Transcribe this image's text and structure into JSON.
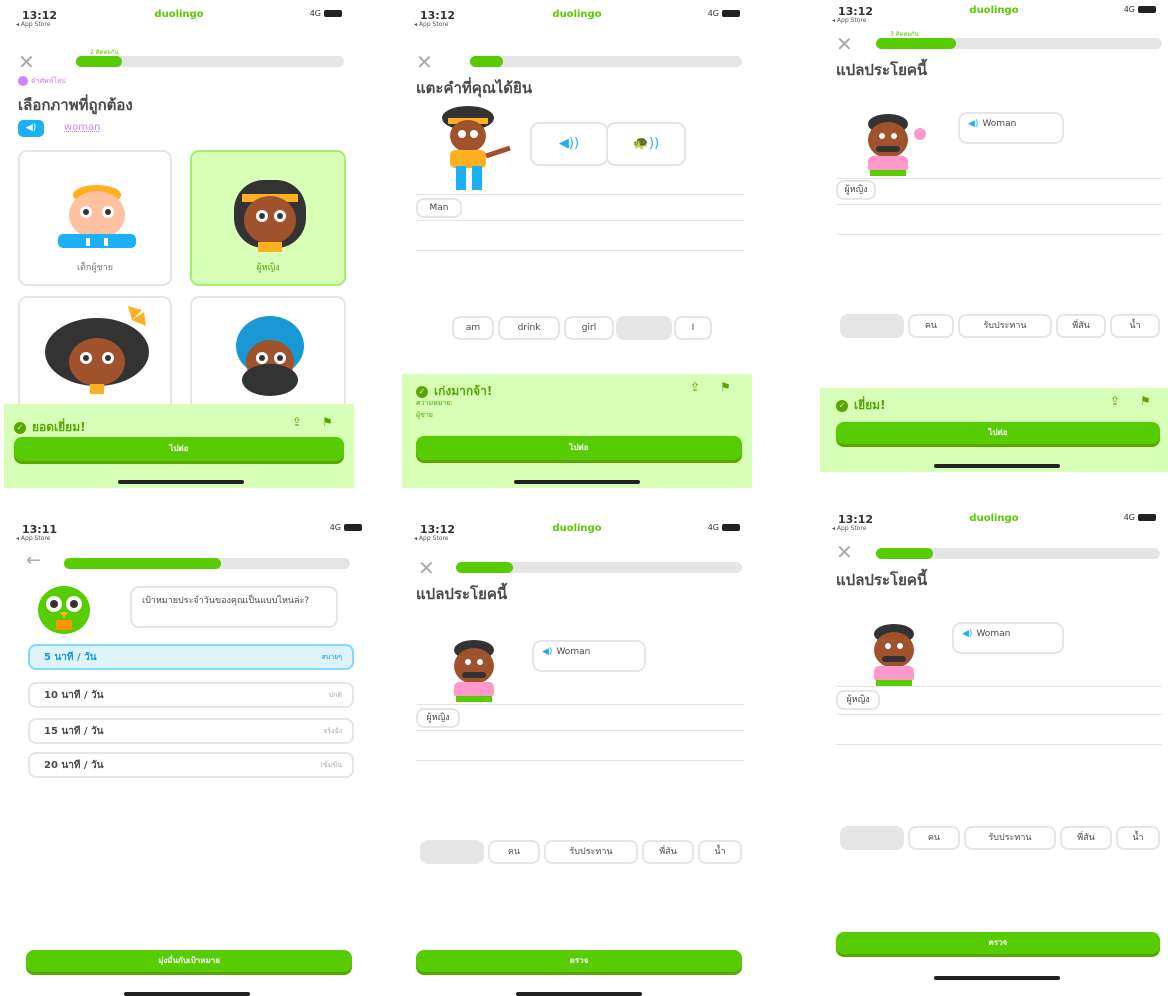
{
  "app": {
    "name": "duolingo",
    "store": "◂ App Store",
    "signal": "4G"
  },
  "colors": {
    "accent": "#58cc02",
    "accent_dark": "#58a700",
    "success_bg": "#d7ffb8",
    "blue": "#1cb0f6",
    "purple": "#ce82ff",
    "track": "#e5e5e5"
  },
  "screens": {
    "s1": {
      "time": "13:12",
      "progress_label": "2 ติดต่อกัน",
      "progress": 0.17,
      "hint": "คำศัพท์ใหม่",
      "title": "เลือกภาพที่ถูกต้อง",
      "word": "woman",
      "cards": [
        {
          "label": "เด็กผู้ชาย",
          "selected": false
        },
        {
          "label": "ผู้หญิง",
          "selected": true
        },
        {
          "label": "",
          "selected": false
        },
        {
          "label": "",
          "selected": false
        }
      ],
      "feedback": "ยอดเยี่ยม!",
      "continue_label": "ไปต่อ"
    },
    "s2": {
      "time": "13:12",
      "progress": 0.12,
      "title": "แตะคำที่คุณได้ยิน",
      "answer_chip": "Man",
      "word_bank": [
        "am",
        "drink",
        "girl",
        "",
        "I"
      ],
      "feedback": "เก่งมากจ้า!",
      "meaning_label": "ความหมาย:",
      "meaning": "ผู้ชาย",
      "continue_label": "ไปต่อ"
    },
    "s3": {
      "time": "13:12",
      "progress_label": "3 ติดต่อกัน",
      "progress": 0.28,
      "title": "แปลประโยคนี้",
      "prompt": "Woman",
      "answer_chip": "ผู้หญิง",
      "word_bank": [
        "",
        "คน",
        "รับประทาน",
        "พี่สัน",
        "น้ำ"
      ],
      "feedback": "เยี่ยม!",
      "continue_label": "ไปต่อ"
    },
    "s4": {
      "time": "13:11",
      "progress": 0.55,
      "question": "เป้าหมายประจำวันของคุณเป็นแบบไหนล่ะ?",
      "options": [
        {
          "label": "5 นาที / วัน",
          "level": "สบายๆ",
          "selected": true
        },
        {
          "label": "10 นาที / วัน",
          "level": "ปกติ",
          "selected": false
        },
        {
          "label": "15 นาที / วัน",
          "level": "จริงจัง",
          "selected": false
        },
        {
          "label": "20 นาที / วัน",
          "level": "เข้มข้น",
          "selected": false
        }
      ],
      "button": "มุ่งมั่นกับเป้าหมาย"
    },
    "s5": {
      "time": "13:12",
      "progress": 0.2,
      "title": "แปลประโยคนี้",
      "prompt": "Woman",
      "answer_chip": "ผู้หญิง",
      "word_bank": [
        "",
        "คน",
        "รับประทาน",
        "พี่สัน",
        "น้ำ"
      ],
      "button": "ตรวจ"
    },
    "s6": {
      "time": "13:12",
      "progress": 0.2,
      "title": "แปลประโยคนี้",
      "prompt": "Woman",
      "answer_chip": "ผู้หญิง",
      "word_bank": [
        "",
        "คน",
        "รับประทาน",
        "พี่สัน",
        "น้ำ"
      ],
      "button": "ตรวจ"
    }
  }
}
